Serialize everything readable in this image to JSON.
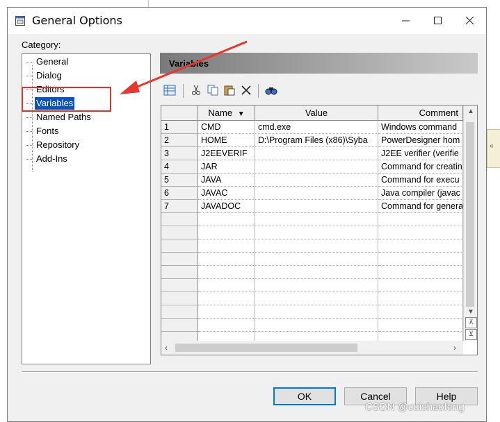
{
  "window": {
    "title": "General Options"
  },
  "category": {
    "label": "Category:",
    "items": [
      "General",
      "Dialog",
      "Editors",
      "Variables",
      "Named Paths",
      "Fonts",
      "Repository",
      "Add-Ins"
    ],
    "selected": "Variables"
  },
  "panel": {
    "title": "Variables"
  },
  "grid": {
    "headers": {
      "name": "Name",
      "value": "Value",
      "comment": "Comment"
    },
    "rows": [
      {
        "num": "1",
        "name": "CMD",
        "value": "cmd.exe",
        "comment": "Windows command"
      },
      {
        "num": "2",
        "name": "HOME",
        "value": "D:\\Program Files (x86)\\Syba",
        "comment": "PowerDesigner hom"
      },
      {
        "num": "3",
        "name": "J2EEVERIF",
        "value": "",
        "comment": "J2EE verifier (verifie"
      },
      {
        "num": "4",
        "name": "JAR",
        "value": "",
        "comment": "Command for creatin"
      },
      {
        "num": "5",
        "name": "JAVA",
        "value": "",
        "comment": "Command for execu"
      },
      {
        "num": "6",
        "name": "JAVAC",
        "value": "",
        "comment": "Java compiler (javac"
      },
      {
        "num": "7",
        "name": "JAVADOC",
        "value": "",
        "comment": "Command for genera"
      }
    ]
  },
  "buttons": {
    "ok": "OK",
    "cancel": "Cancel",
    "help": "Help"
  },
  "watermark": "CSDN @cuishaofeng",
  "colors": {
    "selection": "#0a53be",
    "annotation": "#e0302e",
    "default_button_border": "#0078d7"
  }
}
